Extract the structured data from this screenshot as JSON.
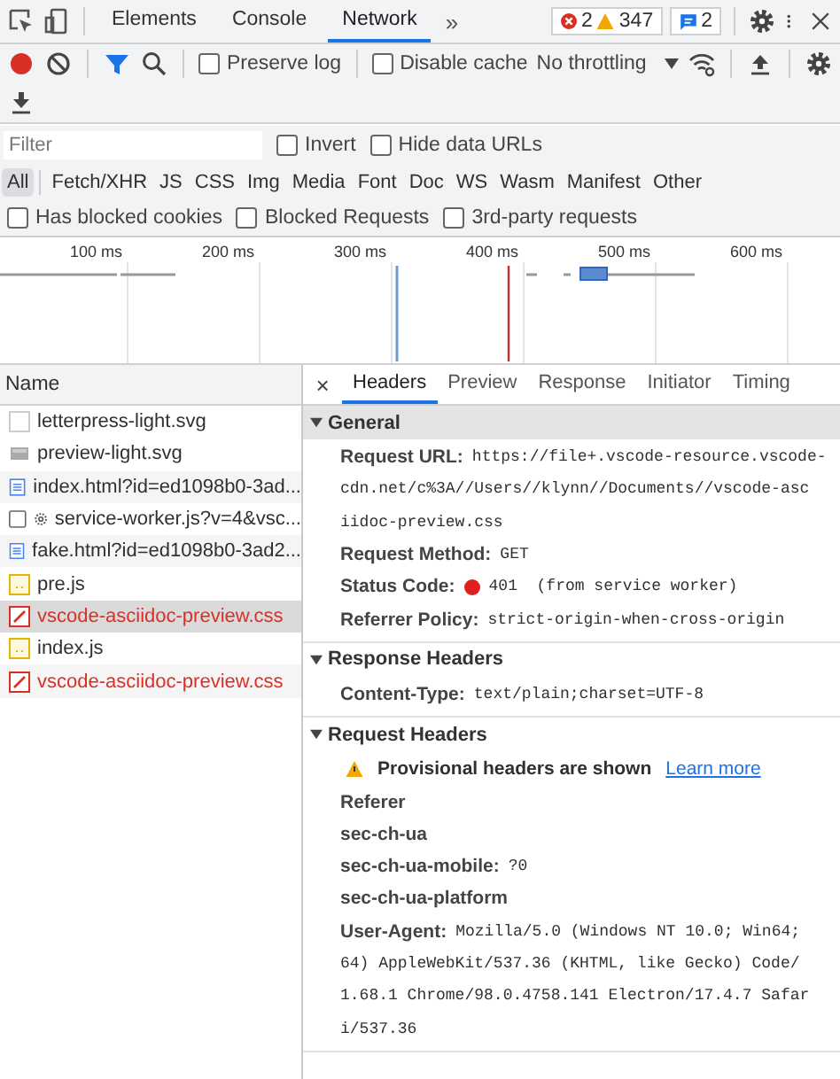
{
  "panel_tabs": [
    {
      "label": "Elements",
      "selected": false
    },
    {
      "label": "Console",
      "selected": false
    },
    {
      "label": "Network",
      "selected": true
    }
  ],
  "more_tabs": "»",
  "counters": {
    "errors": "2",
    "warnings": "347",
    "messages": "2"
  },
  "toolbar": {
    "recording": true,
    "filter_active": true,
    "preserve_log": {
      "label": "Preserve log",
      "checked": false
    },
    "disable_cache": {
      "label": "Disable cache",
      "checked": false
    },
    "throttling": "No throttling"
  },
  "filter": {
    "placeholder": "Filter",
    "options": [
      {
        "label": "Invert",
        "checked": false
      },
      {
        "label": "Hide data URLs",
        "checked": false
      }
    ]
  },
  "types": [
    {
      "label": "All",
      "selected": true
    },
    {
      "label": "Fetch/XHR",
      "selected": false
    },
    {
      "label": "JS",
      "selected": false
    },
    {
      "label": "CSS",
      "selected": false
    },
    {
      "label": "Img",
      "selected": false
    },
    {
      "label": "Media",
      "selected": false
    },
    {
      "label": "Font",
      "selected": false
    },
    {
      "label": "Doc",
      "selected": false
    },
    {
      "label": "WS",
      "selected": false
    },
    {
      "label": "Wasm",
      "selected": false
    },
    {
      "label": "Manifest",
      "selected": false
    },
    {
      "label": "Other",
      "selected": false
    }
  ],
  "blocking_filters": [
    {
      "label": "Has blocked cookies",
      "checked": false
    },
    {
      "label": "Blocked Requests",
      "checked": false
    },
    {
      "label": "3rd-party requests",
      "checked": false
    }
  ],
  "timeline": {
    "ticks": [
      "100 ms",
      "200 ms",
      "300 ms",
      "400 ms",
      "500 ms",
      "600 ms"
    ]
  },
  "requests": {
    "column": "Name",
    "rows": [
      {
        "name": "letterpress-light.svg",
        "kind": "blank",
        "error": false,
        "selected": false
      },
      {
        "name": "preview-light.svg",
        "kind": "image",
        "error": false,
        "selected": false
      },
      {
        "name": "index.html?id=ed1098b0-3ad...",
        "kind": "document",
        "error": false,
        "selected": false
      },
      {
        "name": "service-worker.js?v=4&vsc...",
        "kind": "worker",
        "error": false,
        "selected": false
      },
      {
        "name": "fake.html?id=ed1098b0-3ad2...",
        "kind": "document",
        "error": false,
        "selected": false
      },
      {
        "name": "pre.js",
        "kind": "script",
        "error": false,
        "selected": false
      },
      {
        "name": "vscode-asciidoc-preview.css",
        "kind": "stylesheet",
        "error": true,
        "selected": true
      },
      {
        "name": "index.js",
        "kind": "script",
        "error": false,
        "selected": false
      },
      {
        "name": "vscode-asciidoc-preview.css",
        "kind": "stylesheet",
        "error": true,
        "selected": false
      }
    ]
  },
  "details": {
    "close": "×",
    "tabs": [
      {
        "label": "Headers",
        "selected": true
      },
      {
        "label": "Preview",
        "selected": false
      },
      {
        "label": "Response",
        "selected": false
      },
      {
        "label": "Initiator",
        "selected": false
      },
      {
        "label": "Timing",
        "selected": false
      }
    ],
    "sections": [
      {
        "title": "General",
        "expanded": true,
        "rows": [
          {
            "kind": "field",
            "label": "Request URL:",
            "lines": [
              "https://file+.vscode-resource.vscode-",
              "cdn.net/c%3A//Users//klynn//Documents//vscode-asc",
              "iidoc-preview.css"
            ]
          },
          {
            "kind": "field",
            "label": "Request Method:",
            "lines": [
              "GET"
            ]
          },
          {
            "kind": "status",
            "label": "Status Code:",
            "color": "#e0201e",
            "lines": [
              "401  (from service worker)"
            ]
          },
          {
            "kind": "field",
            "label": "Referrer Policy:",
            "lines": [
              "strict-origin-when-cross-origin"
            ]
          }
        ]
      },
      {
        "title": "Response Headers",
        "expanded": true,
        "rows": [
          {
            "kind": "field",
            "label": "Content-Type:",
            "lines": [
              "text/plain;charset=UTF-8"
            ]
          }
        ]
      },
      {
        "title": "Request Headers",
        "expanded": true,
        "rows": [
          {
            "kind": "warning",
            "text": "Provisional headers are shown",
            "link": "Learn more"
          },
          {
            "kind": "field",
            "label": "Referer"
          },
          {
            "kind": "field",
            "label": "sec-ch-ua"
          },
          {
            "kind": "field",
            "label": "sec-ch-ua-mobile:",
            "lines": [
              "?0"
            ]
          },
          {
            "kind": "field",
            "label": "sec-ch-ua-platform"
          },
          {
            "kind": "field",
            "label": "User-Agent:",
            "lines": [
              "Mozilla/5.0 (Windows NT 10.0; Win64;",
              "64) AppleWebKit/537.36 (KHTML, like Gecko) Code/",
              "1.68.1 Chrome/98.0.4758.141 Electron/17.4.7 Safar",
              "i/537.36"
            ]
          }
        ]
      }
    ]
  }
}
